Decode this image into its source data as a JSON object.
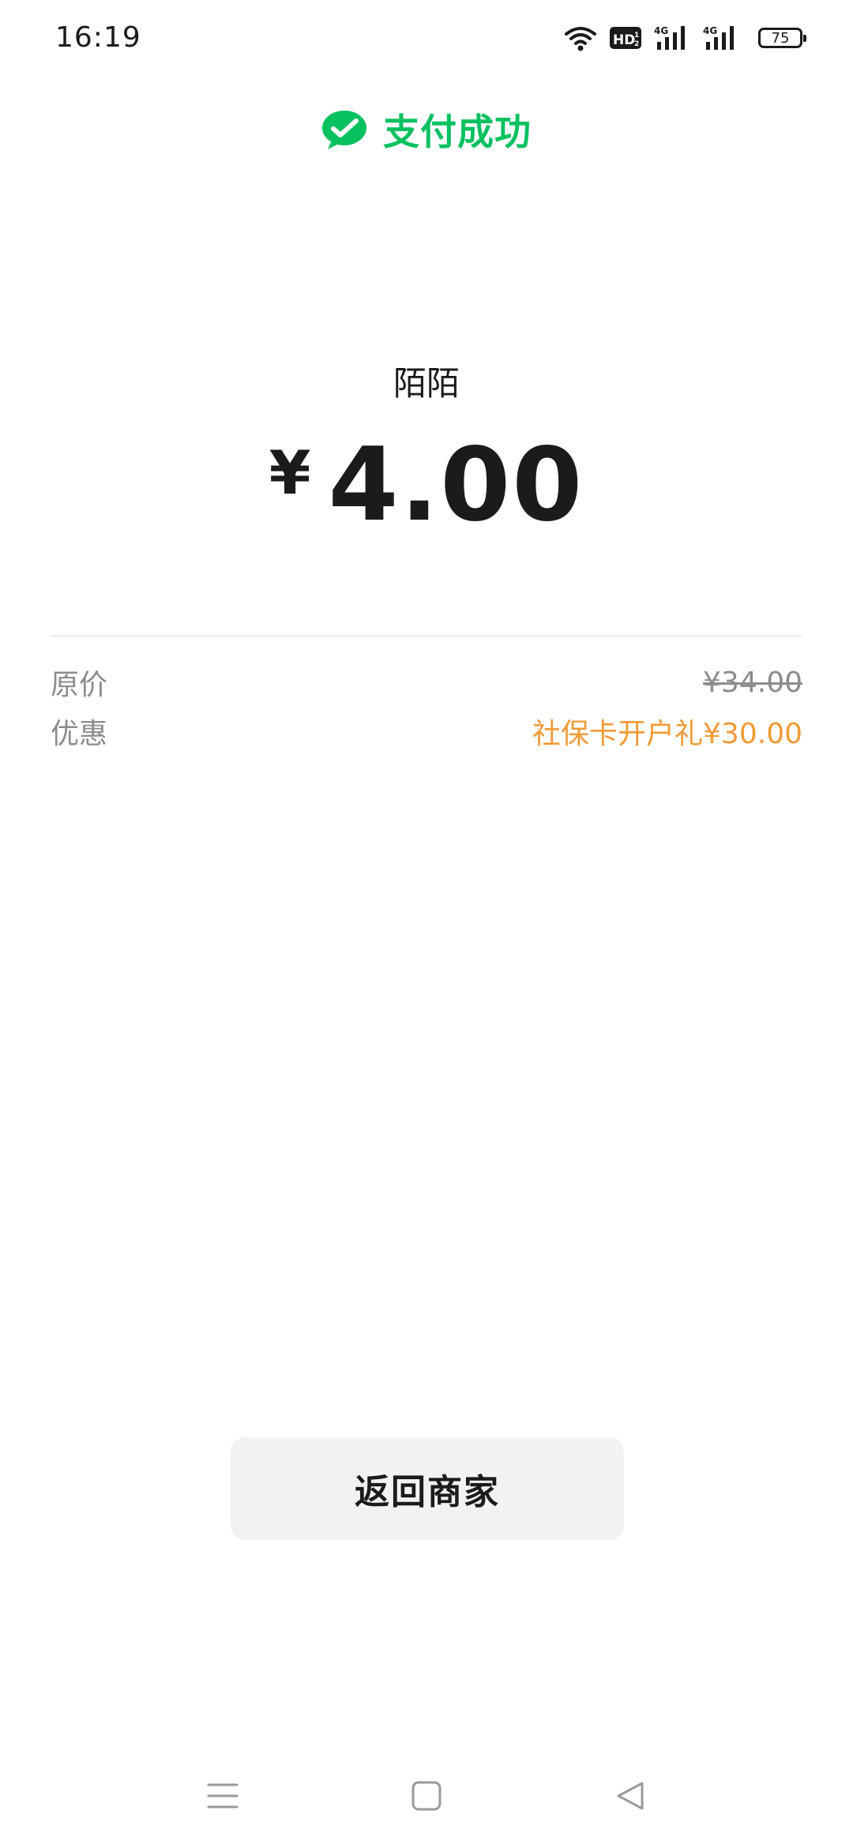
{
  "status_bar": {
    "time": "16:19",
    "network_1": "4G",
    "network_2": "4G",
    "battery_level": "75",
    "icons": [
      "wifi-icon",
      "hd-icon",
      "signal-4g-icon",
      "signal-4g-icon",
      "battery-icon"
    ]
  },
  "header": {
    "title": "支付成功",
    "logo_icon": "wechat-pay-icon",
    "accent_color": "#07c160"
  },
  "payment": {
    "merchant": "陌陌",
    "currency_symbol": "¥",
    "amount": "4.00"
  },
  "details": {
    "original_label": "原价",
    "original_value": "¥34.00",
    "discount_label": "优惠",
    "discount_value": "社保卡开户礼¥30.00",
    "discount_color": "#f09a37"
  },
  "actions": {
    "return_label": "返回商家"
  },
  "nav_bar": {
    "items": [
      "menu-icon",
      "home-icon",
      "back-icon"
    ]
  }
}
